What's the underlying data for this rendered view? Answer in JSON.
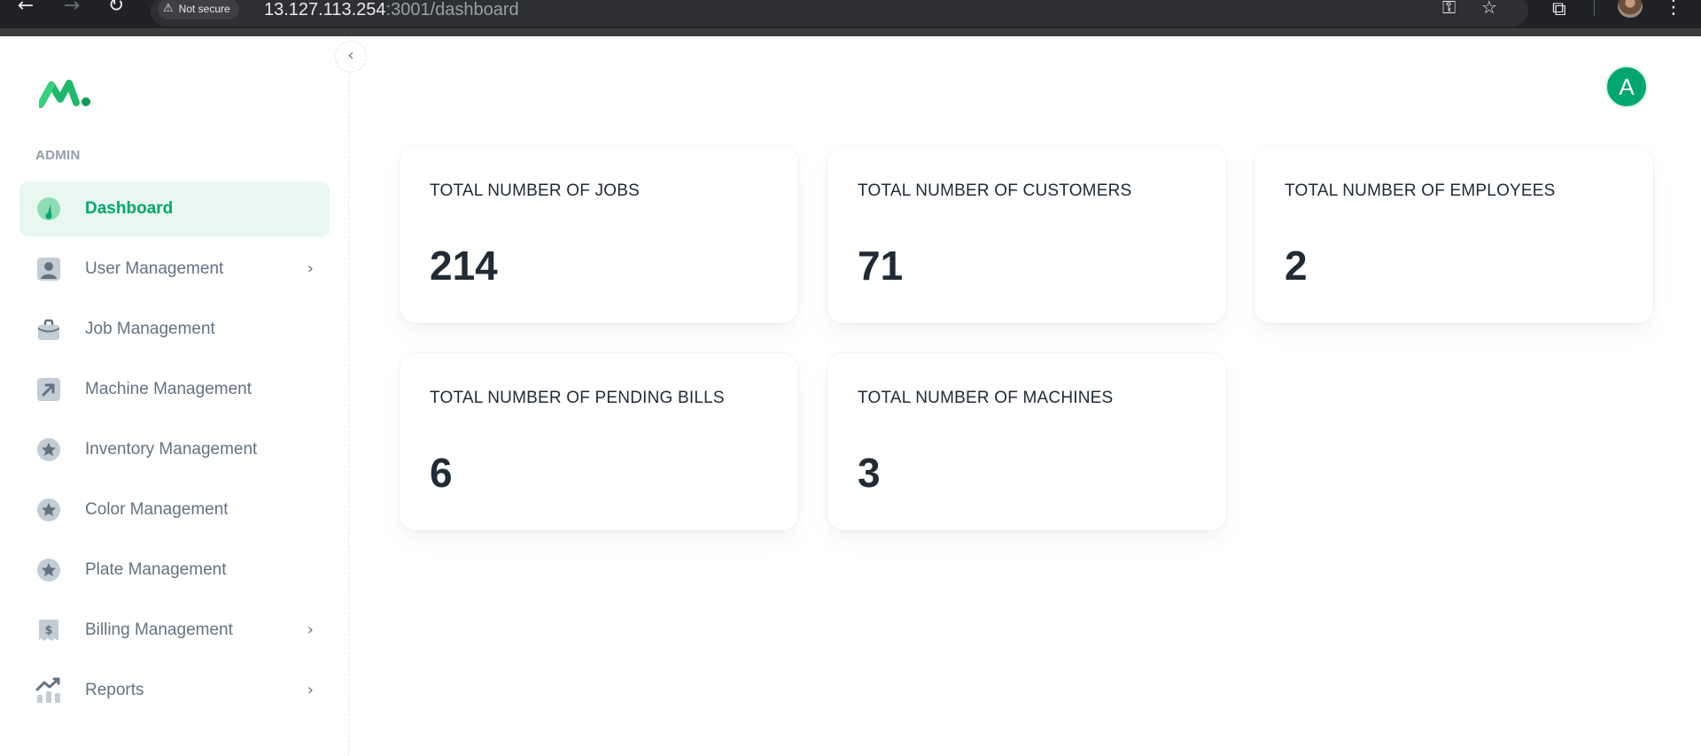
{
  "browser": {
    "security_chip": "Not secure",
    "url_host": "13.127.113.254",
    "url_path": ":3001/dashboard"
  },
  "sidebar": {
    "section_label": "ADMIN",
    "items": [
      {
        "label": "Dashboard",
        "icon": "dashboard-gauge-icon",
        "active": true,
        "has_submenu": false
      },
      {
        "label": "User Management",
        "icon": "user-icon",
        "active": false,
        "has_submenu": true
      },
      {
        "label": "Job Management",
        "icon": "briefcase-icon",
        "active": false,
        "has_submenu": false
      },
      {
        "label": "Machine Management",
        "icon": "arrow-up-right-icon",
        "active": false,
        "has_submenu": false
      },
      {
        "label": "Inventory Management",
        "icon": "star-icon",
        "active": false,
        "has_submenu": false
      },
      {
        "label": "Color Management",
        "icon": "star-icon",
        "active": false,
        "has_submenu": false
      },
      {
        "label": "Plate Management",
        "icon": "star-icon",
        "active": false,
        "has_submenu": false
      },
      {
        "label": "Billing Management",
        "icon": "invoice-dollar-icon",
        "active": false,
        "has_submenu": true
      },
      {
        "label": "Reports",
        "icon": "chart-trend-icon",
        "active": false,
        "has_submenu": true
      }
    ]
  },
  "header": {
    "avatar_initial": "A"
  },
  "stats": [
    {
      "label": "TOTAL NUMBER OF JOBS",
      "value": "214"
    },
    {
      "label": "TOTAL NUMBER OF CUSTOMERS",
      "value": "71"
    },
    {
      "label": "TOTAL NUMBER OF EMPLOYEES",
      "value": "2"
    },
    {
      "label": "TOTAL NUMBER OF PENDING BILLS",
      "value": "6"
    },
    {
      "label": "TOTAL NUMBER OF MACHINES",
      "value": "3"
    }
  ],
  "colors": {
    "brand_green": "#00a76f",
    "active_bg": "#e8f7ef",
    "text_primary": "#212b36",
    "text_secondary": "#637381"
  }
}
